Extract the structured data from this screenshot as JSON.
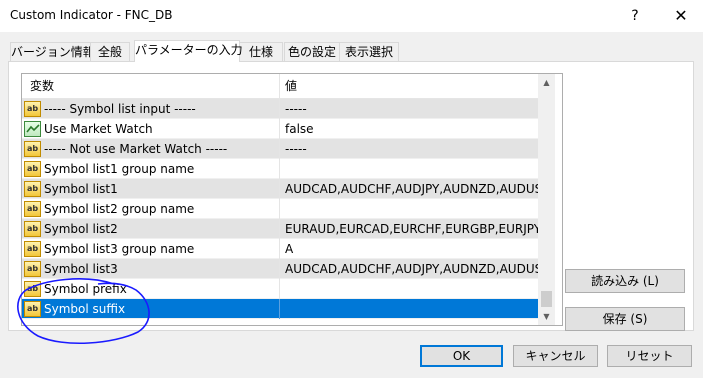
{
  "window": {
    "title": "Custom Indicator - FNC_DB",
    "help_glyph": "?",
    "close_glyph": "✕"
  },
  "tabs": [
    {
      "label": "バージョン情報",
      "active": false
    },
    {
      "label": "全般",
      "active": false
    },
    {
      "label": "パラメーターの入力",
      "active": true
    },
    {
      "label": "仕様",
      "active": false
    },
    {
      "label": "色の設定",
      "active": false
    },
    {
      "label": "表示選択",
      "active": false
    }
  ],
  "grid": {
    "columns": [
      "変数",
      "値"
    ],
    "rows": [
      {
        "icon": "ab",
        "name": "----- Symbol list input -----",
        "value": "-----",
        "shaded": true,
        "selected": false
      },
      {
        "icon": "bool",
        "name": "Use Market Watch",
        "value": "false",
        "shaded": false,
        "selected": false
      },
      {
        "icon": "ab",
        "name": "----- Not use Market Watch -----",
        "value": "-----",
        "shaded": true,
        "selected": false
      },
      {
        "icon": "ab",
        "name": "Symbol list1 group name",
        "value": "",
        "shaded": false,
        "selected": false
      },
      {
        "icon": "ab",
        "name": "Symbol list1",
        "value": "AUDCAD,AUDCHF,AUDJPY,AUDNZD,AUDUSD...",
        "shaded": true,
        "selected": false
      },
      {
        "icon": "ab",
        "name": "Symbol list2 group name",
        "value": "",
        "shaded": false,
        "selected": false
      },
      {
        "icon": "ab",
        "name": "Symbol list2",
        "value": "EURAUD,EURCAD,EURCHF,EURGBP,EURJPY,E...",
        "shaded": true,
        "selected": false
      },
      {
        "icon": "ab",
        "name": "Symbol list3 group name",
        "value": "A",
        "shaded": false,
        "selected": false
      },
      {
        "icon": "ab",
        "name": "Symbol list3",
        "value": "AUDCAD,AUDCHF,AUDJPY,AUDNZD,AUDUSD...",
        "shaded": true,
        "selected": false
      },
      {
        "icon": "ab",
        "name": "Symbol prefix",
        "value": "",
        "shaded": false,
        "selected": false
      },
      {
        "icon": "ab",
        "name": "Symbol suffix",
        "value": "",
        "shaded": false,
        "selected": true
      }
    ]
  },
  "buttons": {
    "load": "読み込み (L)",
    "save": "保存 (S)",
    "ok": "OK",
    "cancel": "キャンセル",
    "reset": "リセット"
  },
  "icons": {
    "string_param": "ab-icon",
    "bool_param": "check-chart-icon"
  },
  "colors": {
    "selection": "#0078d7",
    "annotation": "#1a1aff"
  }
}
